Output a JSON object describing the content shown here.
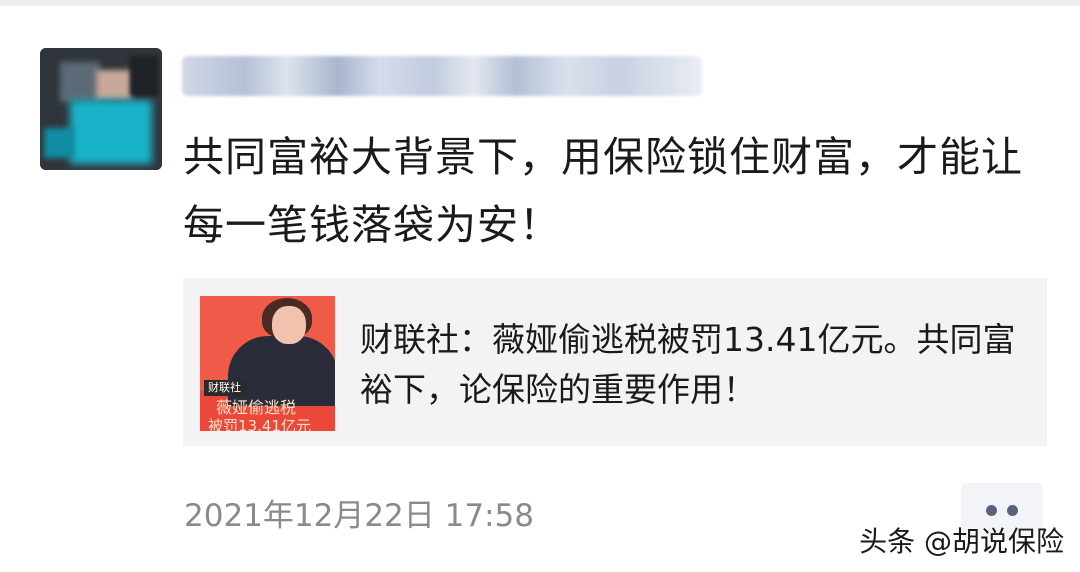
{
  "post": {
    "text": "共同富裕大背景下，用保险锁住财富，才能让每一笔钱落袋为安！",
    "timestamp": "2021年12月22日 17:58"
  },
  "shared_link": {
    "title": "财联社：薇娅偷逃税被罚13.41亿元。共同富裕下，论保险的重要作用！",
    "thumbnail": {
      "tag": "财联社",
      "line1": "薇娅偷逃税",
      "line2": "被罚13.41亿元"
    }
  },
  "more_button": {
    "icon": "ellipsis-icon"
  },
  "watermark": {
    "text": "头条 @胡说保险"
  },
  "colors": {
    "text": "#1a1a1a",
    "timestamp": "#8a8a8a",
    "card_bg": "#f3f3f3",
    "more_dots": "#58627a",
    "thumbnail_red": "#f05a48"
  }
}
